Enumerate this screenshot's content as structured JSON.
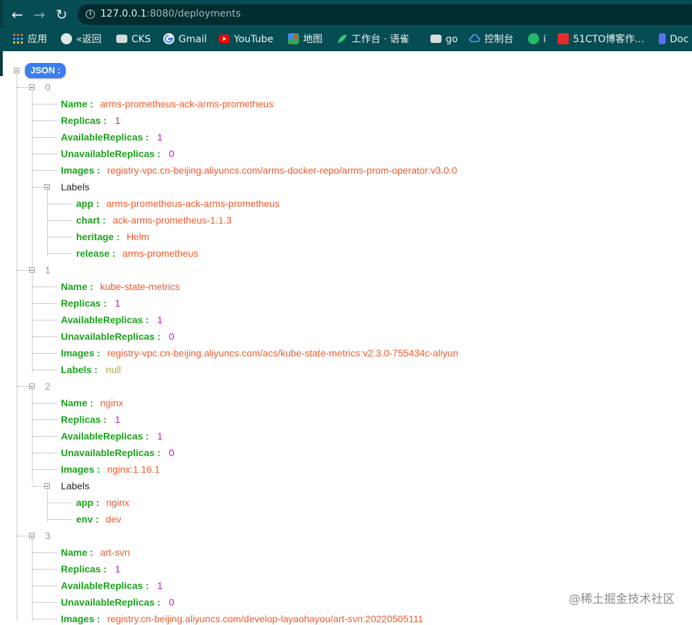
{
  "browser": {
    "url_host": "127.0.0.1",
    "url_rest": ":8080/deployments",
    "bookmarks": [
      "应用",
      "«返回",
      "CKS",
      "Gmail",
      "YouTube",
      "地图",
      "工作台 · 语雀",
      "go",
      "控制台",
      "i",
      "51CTO博客作…",
      "Doc"
    ]
  },
  "json_view": {
    "root_label": "JSON :",
    "items": [
      {
        "index": "0",
        "name": "arms-prometheus-ack-arms-prometheus",
        "replicas": "1",
        "available": "1",
        "unavailable": "0",
        "images": "registry-vpc.cn-beijing.aliyuncs.com/arms-docker-repo/arms-prom-operator:v3.0.0",
        "labels": [
          {
            "key": "app",
            "value": "arms-prometheus-ack-arms-prometheus"
          },
          {
            "key": "chart",
            "value": "ack-arms-prometheus-1.1.3"
          },
          {
            "key": "heritage",
            "value": "Helm"
          },
          {
            "key": "release",
            "value": "arms-prometheus"
          }
        ]
      },
      {
        "index": "1",
        "name": "kube-state-metrics",
        "replicas": "1",
        "available": "1",
        "unavailable": "0",
        "images": "registry-vpc.cn-beijing.aliyuncs.com/acs/kube-state-metrics:v2.3.0-755434c-aliyun",
        "labels_value": "null"
      },
      {
        "index": "2",
        "name": "nginx",
        "replicas": "1",
        "available": "1",
        "unavailable": "0",
        "images": "nginx:1.16.1",
        "labels": [
          {
            "key": "app",
            "value": "nginx"
          },
          {
            "key": "env",
            "value": "dev"
          }
        ]
      },
      {
        "index": "3",
        "name": "art-svn",
        "replicas": "1",
        "available": "1",
        "unavailable": "0",
        "images": "registry.cn-beijing.aliyuncs.com/develop-layaohayou/art-svn:20220505111"
      }
    ],
    "field_keys": {
      "name": "Name :",
      "replicas": "Replicas :",
      "available": "AvailableReplicas :",
      "unavailable": "UnavailableReplicas :",
      "images": "Images :",
      "labels_plain": "Labels",
      "labels_key": "Labels :"
    }
  },
  "watermark": "@稀土掘金技术社区",
  "colors": {
    "toolbar": "#064c53",
    "key": "#1aa31a",
    "string": "#f1592a",
    "number": "#c515c5",
    "null": "#a8a83a",
    "badge": "#3b7ef0"
  }
}
